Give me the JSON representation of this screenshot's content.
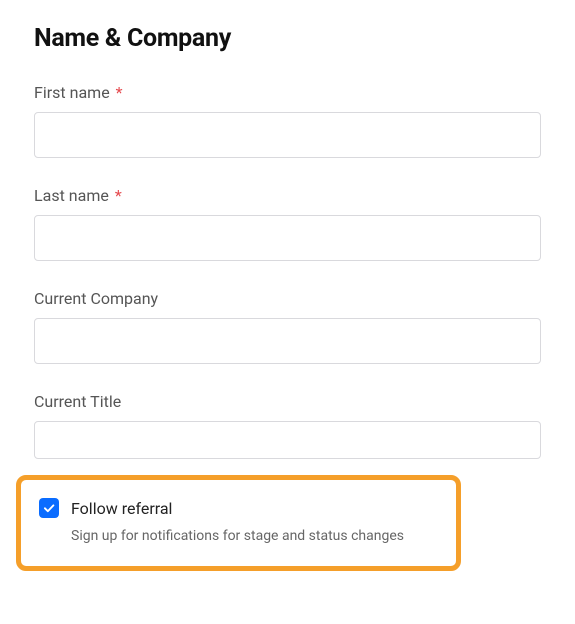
{
  "title": "Name & Company",
  "required_mark": "*",
  "fields": {
    "first_name": {
      "label": "First name",
      "required": true,
      "value": ""
    },
    "last_name": {
      "label": "Last name",
      "required": true,
      "value": ""
    },
    "current_company": {
      "label": "Current Company",
      "required": false,
      "value": ""
    },
    "current_title": {
      "label": "Current Title",
      "required": false,
      "value": ""
    }
  },
  "follow": {
    "checked": true,
    "label": "Follow referral",
    "description": "Sign up for notifications for stage and status changes"
  },
  "colors": {
    "highlight_border": "#f59f2a",
    "checkbox_bg": "#0a6cff",
    "required_star": "#e5484d"
  }
}
